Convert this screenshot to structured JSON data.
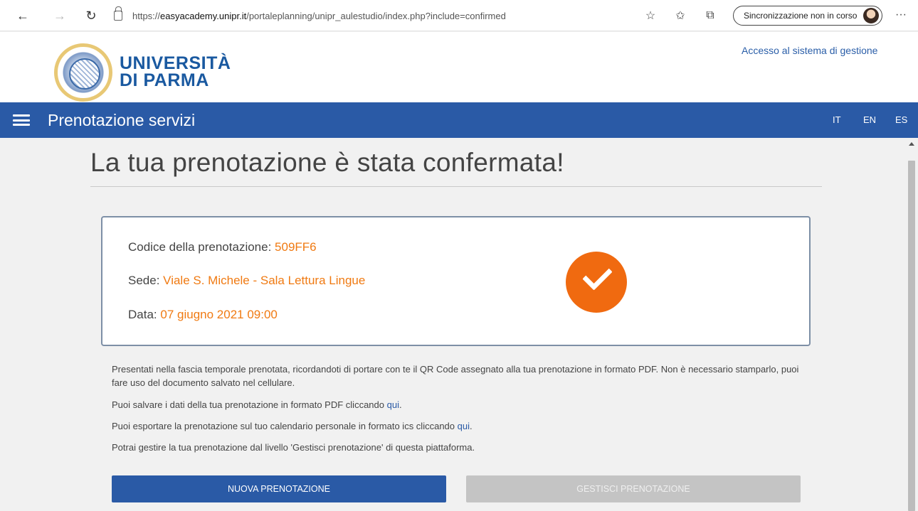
{
  "browser": {
    "url_prefix": "https://",
    "url_domain": "easyacademy.unipr.it",
    "url_path": "/portaleplanning/unipr_aulestudio/index.php?include=confirmed",
    "sync_status": "Sincronizzazione non in corso",
    "icons": [
      "back-icon",
      "forward-icon",
      "refresh-icon",
      "lock-icon",
      "add-favorite-icon",
      "favorites-icon",
      "collections-icon",
      "profile-icon",
      "more-icon"
    ]
  },
  "header": {
    "university_line1": "UNIVERSITÀ",
    "university_line2": "DI PARMA",
    "management_link": "Accesso al sistema di gestione"
  },
  "nav": {
    "title": "Prenotazione servizi",
    "languages": [
      "IT",
      "EN",
      "ES"
    ]
  },
  "main": {
    "title": "La tua prenotazione è stata confermata!",
    "booking": {
      "code_label": "Codice della prenotazione:",
      "code_value": "509FF6",
      "site_label": "Sede:",
      "site_value": "Viale S. Michele - Sala Lettura Lingue",
      "date_label": "Data:",
      "date_value": "07 giugno 2021 09:00"
    },
    "info": {
      "p1": "Presentati nella fascia temporale prenotata, ricordandoti di portare con te il QR Code assegnato alla tua prenotazione in formato PDF. Non è necessario stamparlo, puoi fare uso del documento salvato nel cellulare.",
      "p2_text": "Puoi salvare i dati della tua prenotazione in formato PDF cliccando ",
      "p2_link": "qui",
      "p3_text": "Puoi esportare la prenotazione sul tuo calendario personale in formato ics cliccando ",
      "p3_link": "qui",
      "p4": "Potrai gestire la tua prenotazione dal livello 'Gestisci prenotazione' di questa piattaforma."
    },
    "buttons": {
      "new_booking": "NUOVA PRENOTAZIONE",
      "manage_booking": "GESTISCI PRENOTAZIONE"
    }
  },
  "colors": {
    "brand_blue": "#2a5aa6",
    "accent_orange": "#f07a12"
  }
}
